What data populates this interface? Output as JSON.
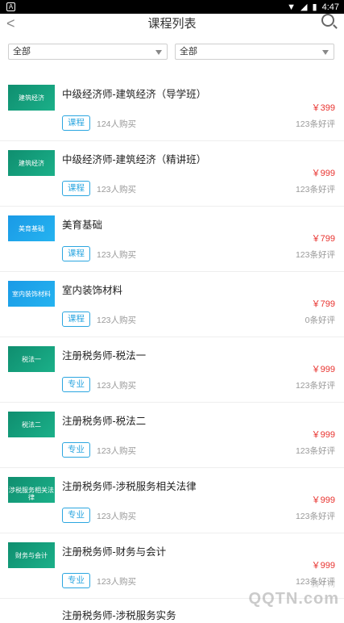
{
  "statusbar": {
    "left_icon": "A",
    "time": "4:47"
  },
  "header": {
    "title": "课程列表"
  },
  "filters": [
    {
      "value": "全部"
    },
    {
      "value": "全部"
    }
  ],
  "courses": [
    {
      "title": "中级经济师-建筑经济（导学班）",
      "thumb_text": "建筑经济",
      "thumb_color": "green",
      "price": "￥399",
      "tag": "课程",
      "buyers": "124人购买",
      "reviews": "123条好评"
    },
    {
      "title": "中级经济师-建筑经济（精讲班）",
      "thumb_text": "建筑经济",
      "thumb_color": "green",
      "price": "￥999",
      "tag": "课程",
      "buyers": "123人购买",
      "reviews": "123条好评"
    },
    {
      "title": "美育基础",
      "thumb_text": "美育基础",
      "thumb_color": "blue",
      "price": "￥799",
      "tag": "课程",
      "buyers": "123人购买",
      "reviews": "123条好评"
    },
    {
      "title": "室内装饰材料",
      "thumb_text": "室内装饰材料",
      "thumb_color": "blue",
      "price": "￥799",
      "tag": "课程",
      "buyers": "123人购买",
      "reviews": "0条好评"
    },
    {
      "title": "注册税务师-税法一",
      "thumb_text": "税法一",
      "thumb_color": "green",
      "price": "￥999",
      "tag": "专业",
      "buyers": "123人购买",
      "reviews": "123条好评"
    },
    {
      "title": "注册税务师-税法二",
      "thumb_text": "税法二",
      "thumb_color": "green",
      "price": "￥999",
      "tag": "专业",
      "buyers": "123人购买",
      "reviews": "123条好评"
    },
    {
      "title": "注册税务师-涉税服务相关法律",
      "thumb_text": "涉税服务相关法律",
      "thumb_color": "green",
      "price": "￥999",
      "tag": "专业",
      "buyers": "123人购买",
      "reviews": "123条好评"
    },
    {
      "title": "注册税务师-财务与会计",
      "thumb_text": "财务与会计",
      "thumb_color": "green",
      "price": "￥999",
      "tag": "专业",
      "buyers": "123人购买",
      "reviews": "123条好评"
    }
  ],
  "partial_item": {
    "title": "注册税务师-涉税服务实务"
  },
  "watermark": {
    "main": "QQTN.com",
    "small": "腾牛网"
  },
  "icons": {
    "back": "back-arrow-icon",
    "search": "search-icon",
    "dropdown": "chevron-down-icon"
  }
}
